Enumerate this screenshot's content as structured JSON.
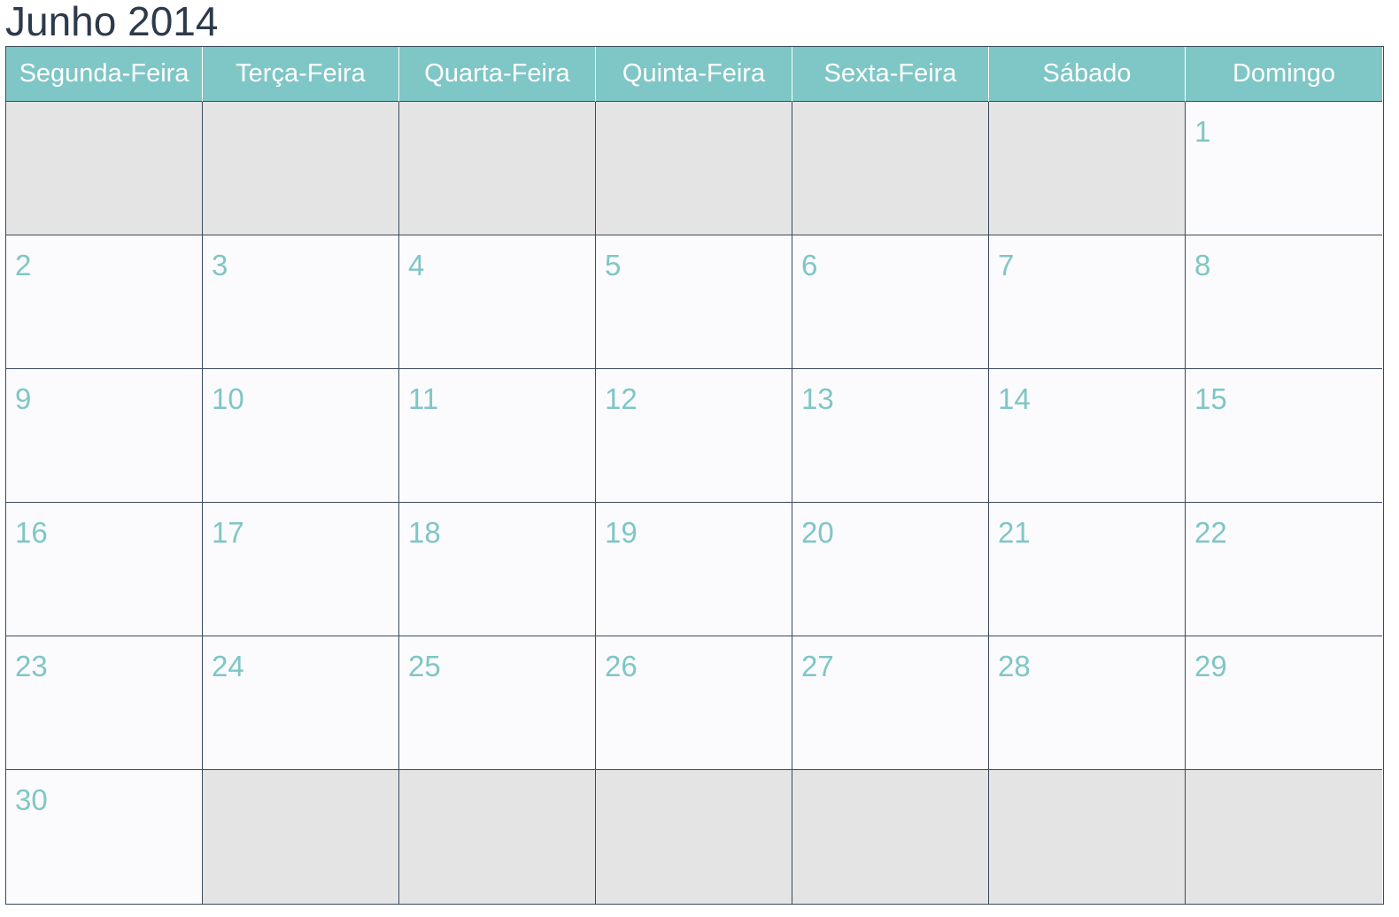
{
  "title": "Junho 2014",
  "colors": {
    "header_bg": "#7fc6c6",
    "day_number": "#7fc6c6",
    "empty_cell": "#e4e4e4",
    "grid_line": "#3b4a5c",
    "title_text": "#2d3a4c"
  },
  "weekdays": [
    "Segunda-Feira",
    "Terça-Feira",
    "Quarta-Feira",
    "Quinta-Feira",
    "Sexta-Feira",
    "Sábado",
    "Domingo"
  ],
  "weeks": [
    [
      "",
      "",
      "",
      "",
      "",
      "",
      "1"
    ],
    [
      "2",
      "3",
      "4",
      "5",
      "6",
      "7",
      "8"
    ],
    [
      "9",
      "10",
      "11",
      "12",
      "13",
      "14",
      "15"
    ],
    [
      "16",
      "17",
      "18",
      "19",
      "20",
      "21",
      "22"
    ],
    [
      "23",
      "24",
      "25",
      "26",
      "27",
      "28",
      "29"
    ],
    [
      "30",
      "",
      "",
      "",
      "",
      "",
      ""
    ]
  ]
}
